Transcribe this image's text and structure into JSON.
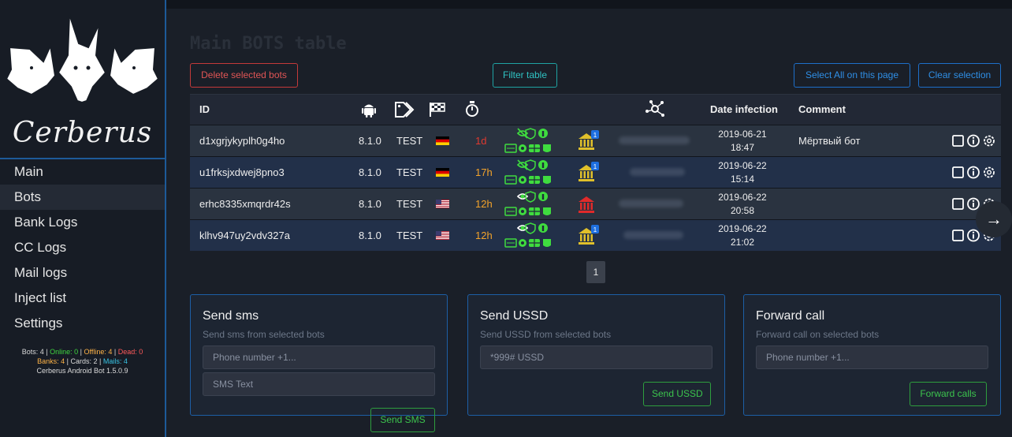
{
  "sidebar": {
    "logo_text": "Cerberus",
    "items": [
      {
        "label": "Main"
      },
      {
        "label": "Bots"
      },
      {
        "label": "Bank Logs"
      },
      {
        "label": "CC Logs"
      },
      {
        "label": "Mail logs"
      },
      {
        "label": "Inject list"
      },
      {
        "label": "Settings"
      }
    ],
    "active_index": 1,
    "stats": {
      "bots": "Bots: 4",
      "online": "Online: 0",
      "offline": "Offline: 4",
      "dead": "Dead: 0",
      "banks": "Banks: 4",
      "cards": "Cards: 2",
      "mails": "Mails: 4",
      "version": "Cerberus Android Bot 1.5.0.9"
    }
  },
  "main": {
    "title": "Main BOTS table",
    "buttons": {
      "delete": "Delete selected bots",
      "filter": "Filter table",
      "select_all": "Select All on this page",
      "clear": "Clear selection"
    },
    "table": {
      "headers": {
        "id": "ID",
        "android_icon": "android-icon",
        "tag_icon": "tag-icon",
        "flag_icon": "checkered-flag-icon",
        "timer_icon": "stopwatch-icon",
        "network_icon": "network-icon",
        "date": "Date infection",
        "comment": "Comment"
      },
      "rows": [
        {
          "id": "d1xgrjykyplh0g4ho",
          "version": "8.1.0",
          "tag": "TEST",
          "country": "de",
          "last_seen": "1d",
          "last_seen_color": "#e0392f",
          "eye": "crossed",
          "bank_color": "#e0c02a",
          "bank_badge": "1",
          "date": "2019-06-21",
          "time": "18:47",
          "comment": "Мёртвый бот"
        },
        {
          "id": "u1frksjxdwej8pno3",
          "version": "8.1.0",
          "tag": "TEST",
          "country": "de",
          "last_seen": "17h",
          "last_seen_color": "#f3a32a",
          "eye": "crossed",
          "bank_color": "#e0c02a",
          "bank_badge": "1",
          "date": "2019-06-22",
          "time": "15:14",
          "comment": ""
        },
        {
          "id": "erhc8335xmqrdr42s",
          "version": "8.1.0",
          "tag": "TEST",
          "country": "us",
          "last_seen": "12h",
          "last_seen_color": "#f3a32a",
          "eye": "open",
          "bank_color": "#e02a2a",
          "bank_badge": "",
          "date": "2019-06-22",
          "time": "20:58",
          "comment": ""
        },
        {
          "id": "klhv947uy2vdv327a",
          "version": "8.1.0",
          "tag": "TEST",
          "country": "us",
          "last_seen": "12h",
          "last_seen_color": "#f3a32a",
          "eye": "open",
          "bank_color": "#e0c02a",
          "bank_badge": "1",
          "date": "2019-06-22",
          "time": "21:02",
          "comment": ""
        }
      ]
    },
    "pagination": {
      "current": "1"
    }
  },
  "cards": {
    "sms": {
      "title": "Send sms",
      "subtitle": "Send sms from selected bots",
      "phone_placeholder": "Phone number +1...",
      "text_placeholder": "SMS Text",
      "button": "Send SMS"
    },
    "ussd": {
      "title": "Send USSD",
      "subtitle": "Send USSD from selected bots",
      "placeholder": "*999# USSD",
      "button": "Send USSD"
    },
    "forward": {
      "title": "Forward call",
      "subtitle": "Forward call on selected bots",
      "placeholder": "Phone number +1...",
      "button": "Forward calls"
    }
  },
  "colors": {
    "accent_blue": "#1d5a99",
    "green": "#3cc44d",
    "red": "#e05555",
    "teal": "#2fc3c3"
  }
}
